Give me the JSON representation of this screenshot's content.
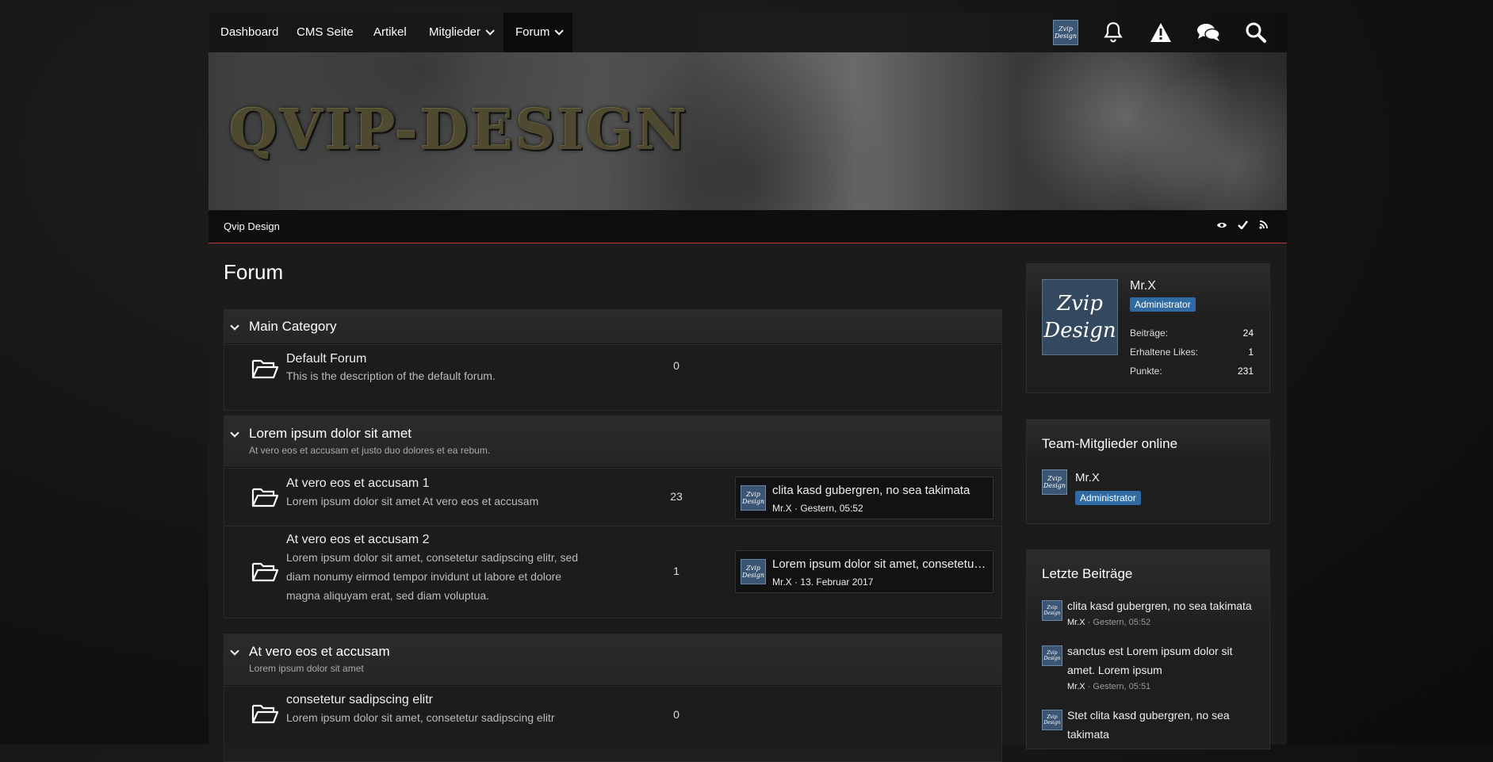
{
  "nav": {
    "items": [
      {
        "label": "Dashboard"
      },
      {
        "label": "CMS Seite"
      },
      {
        "label": "Artikel"
      },
      {
        "label": "Mitglieder"
      },
      {
        "label": "Forum"
      }
    ],
    "icons": [
      "avatar",
      "bell-icon",
      "warning-icon",
      "chat-icon",
      "search-icon"
    ],
    "avatar_text": "Zvip Design"
  },
  "banner": {
    "logo_text": "QVIP-DESIGN"
  },
  "breadcrumb": {
    "label": "Qvip Design"
  },
  "page": {
    "title": "Forum"
  },
  "categories": [
    {
      "title": "Main Category",
      "desc": "",
      "forums": [
        {
          "title": "Default Forum",
          "desc": "This is the description of the default forum.",
          "count": "0"
        }
      ]
    },
    {
      "title": "Lorem ipsum dolor sit amet",
      "desc": "At vero eos et accusam et justo duo dolores et ea rebum.",
      "forums": [
        {
          "title": "At vero eos et accusam 1",
          "desc": "Lorem ipsum dolor sit amet At vero eos et accusam",
          "count": "23",
          "last": {
            "title": "clita kasd gubergren, no sea takimata",
            "user": "Mr.X",
            "time": "Gestern, 05:52"
          }
        },
        {
          "title": "At vero eos et accusam 2",
          "desc_lines": [
            "Lorem ipsum dolor sit amet, consetetur sadipscing elitr, sed",
            "diam nonumy eirmod tempor invidunt ut labore et dolore",
            "magna aliquyam erat, sed diam voluptua."
          ],
          "count": "1",
          "last": {
            "title": "Lorem ipsum dolor sit amet, consetetur s...",
            "user": "Mr.X",
            "time": "13. Februar 2017"
          }
        }
      ]
    },
    {
      "title": "At vero eos et accusam",
      "desc": "Lorem ipsum dolor sit amet",
      "forums": [
        {
          "title": "consetetur sadipscing elitr",
          "desc": "Lorem ipsum dolor sit amet, consetetur sadipscing elitr",
          "count": "0"
        }
      ]
    }
  ],
  "sidebar": {
    "user": {
      "avatar_text": "Zvip Design",
      "name": "Mr.X",
      "rank": "Administrator",
      "stats": [
        {
          "label": "Beiträge:",
          "value": "24"
        },
        {
          "label": "Erhaltene Likes:",
          "value": "1"
        },
        {
          "label": "Punkte:",
          "value": "231"
        }
      ]
    },
    "team": {
      "title": "Team-Mitglieder online",
      "name": "Mr.X",
      "rank": "Administrator"
    },
    "recent": {
      "title": "Letzte Beiträge",
      "posts": [
        {
          "title": "clita kasd gubergren, no sea takimata",
          "user": "Mr.X",
          "time": "Gestern, 05:52"
        },
        {
          "title": "sanctus est Lorem ipsum dolor sit amet. Lorem ipsum",
          "user": "Mr.X",
          "time": "Gestern, 05:51"
        },
        {
          "title": "Stet clita kasd gubergren, no sea takimata",
          "user": "",
          "time": ""
        }
      ]
    }
  },
  "colors": {
    "accent": "#b23a3a",
    "badge": "#2f6aa3"
  }
}
